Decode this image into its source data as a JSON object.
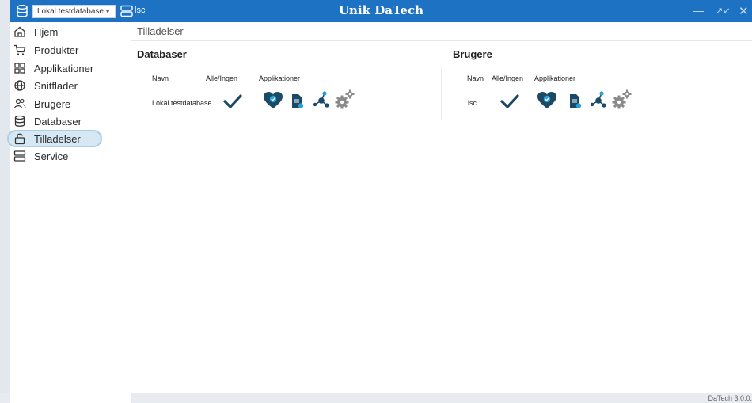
{
  "titlebar": {
    "database_value": "Lokal testdatabase",
    "user": "lsc",
    "title": "Unik DaTech",
    "minimize": "—",
    "restore": "↗↙",
    "close": "✕"
  },
  "sidebar": {
    "items": [
      {
        "label": "Hjem",
        "icon": "home-icon"
      },
      {
        "label": "Produkter",
        "icon": "cart-icon"
      },
      {
        "label": "Applikationer",
        "icon": "apps-grid-icon"
      },
      {
        "label": "Snitflader",
        "icon": "globe-icon"
      },
      {
        "label": "Brugere",
        "icon": "users-icon"
      },
      {
        "label": "Databaser",
        "icon": "database-icon"
      },
      {
        "label": "Tilladelser",
        "icon": "lock-icon",
        "active": true
      },
      {
        "label": "Service",
        "icon": "server-icon"
      }
    ]
  },
  "breadcrumb": "Tilladelser",
  "databases": {
    "title": "Databaser",
    "col_name": "Navn",
    "col_all": "Alle/Ingen",
    "col_apps": "Applikationer",
    "rows": [
      {
        "name": "Lokal testdatabase"
      }
    ]
  },
  "users": {
    "title": "Brugere",
    "col_name": "Navn",
    "col_all": "Alle/Ingen",
    "col_apps": "Applikationer",
    "rows": [
      {
        "name": "lsc"
      }
    ]
  },
  "colors": {
    "accent": "#1d72c4",
    "icon_dark": "#1b4a66",
    "icon_accent": "#2a9fd6",
    "gear": "#8a8a8a"
  },
  "footer": {
    "version": "DaTech 3.0.0."
  }
}
